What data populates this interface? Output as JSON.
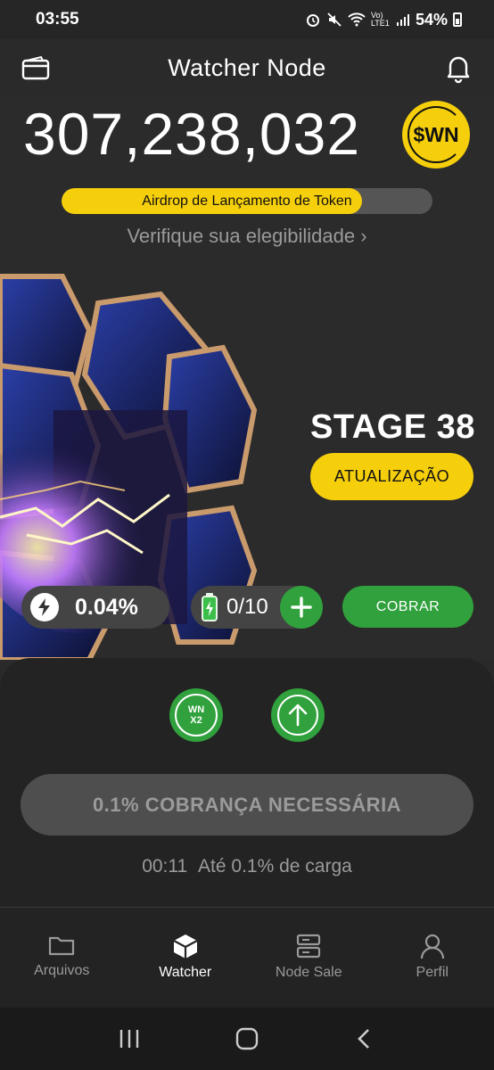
{
  "status_bar": {
    "time": "03:55",
    "network": "Vo) LTE1",
    "battery": "54%"
  },
  "header": {
    "title": "Watcher Node"
  },
  "balance": {
    "amount": "307,238,032",
    "token": "$WN"
  },
  "airdrop": {
    "label": "Airdrop de Lançamento de Token",
    "progress_percent": 81
  },
  "eligibility": {
    "link_text": "Verifique sua elegibilidade ›"
  },
  "stage": {
    "label": "STAGE 38",
    "upgrade_label": "ATUALIZAÇÃO"
  },
  "stats": {
    "rate": "0.04%",
    "battery": "0/10",
    "collect_label": "COBRAR"
  },
  "sheet": {
    "boost_label_line1": "WN",
    "boost_label_line2": "X2",
    "charge_button": "0.1% COBRANÇA NECESSÁRIA",
    "timer": "00:11",
    "timer_text": "Até 0.1% de carga"
  },
  "tabs": [
    {
      "label": "Arquivos"
    },
    {
      "label": "Watcher"
    },
    {
      "label": "Node Sale"
    },
    {
      "label": "Perfil"
    }
  ],
  "colors": {
    "accent_yellow": "#f6cf0c",
    "accent_green": "#30a13c",
    "background": "#2a2a2a"
  }
}
